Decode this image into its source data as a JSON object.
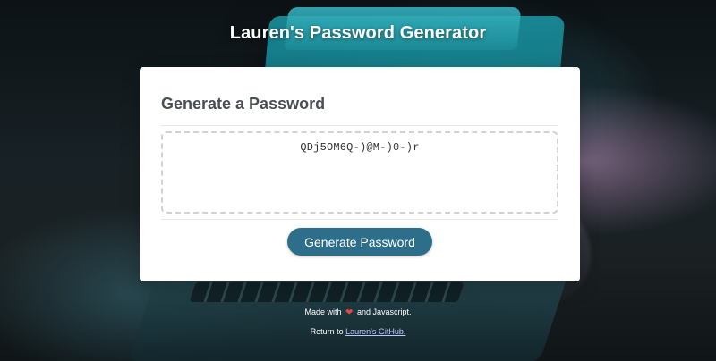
{
  "header": {
    "title": "Lauren's Password Generator"
  },
  "card": {
    "title": "Generate a Password",
    "password": "QDj5OM6Q-)@M-)0-)r",
    "button_label": "Generate Password"
  },
  "footer": {
    "made_prefix": "Made with",
    "heart_icon": "❤",
    "made_suffix": "and Javascript.",
    "return_prefix": "Return to",
    "github_link": "Lauren's GitHub."
  },
  "colors": {
    "button": "#2d6f8a",
    "heart": "#e64545",
    "card": "#ffffff",
    "dashed_border": "#d2d2d2"
  }
}
